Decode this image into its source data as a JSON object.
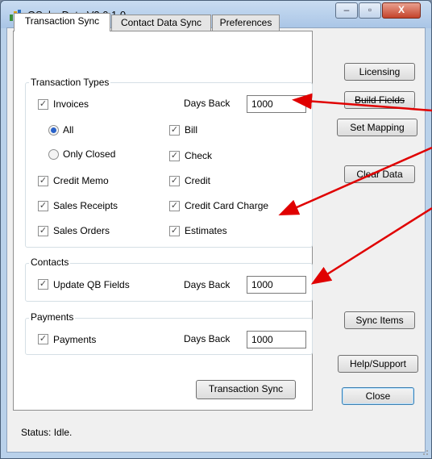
{
  "window": {
    "title": "QSalesData V3.0.1.0",
    "controls": {
      "minimize": "–",
      "maximize": "▫",
      "close": "X"
    }
  },
  "tabs": [
    {
      "label": "Transaction Sync",
      "active": true
    },
    {
      "label": "Contact Data Sync",
      "active": false
    },
    {
      "label": "Preferences",
      "active": false
    }
  ],
  "transaction_types": {
    "title": "Transaction Types",
    "invoices": {
      "label": "Invoices",
      "checked": true
    },
    "days_back_label": "Days Back",
    "days_back_value": "1000",
    "all": {
      "label": "All",
      "selected": true
    },
    "only_closed": {
      "label": "Only Closed",
      "selected": false
    },
    "bill": {
      "label": "Bill",
      "checked": true
    },
    "check": {
      "label": "Check",
      "checked": true
    },
    "credit_memo": {
      "label": "Credit Memo",
      "checked": true
    },
    "credit": {
      "label": "Credit",
      "checked": true
    },
    "sales_receipts": {
      "label": "Sales Receipts",
      "checked": true
    },
    "credit_card_charge": {
      "label": "Credit Card Charge",
      "checked": true
    },
    "sales_orders": {
      "label": "Sales Orders",
      "checked": true
    },
    "estimates": {
      "label": "Estimates",
      "checked": true
    }
  },
  "contacts": {
    "title": "Contacts",
    "update_qb_fields": {
      "label": "Update QB Fields",
      "checked": true
    },
    "days_back_label": "Days Back",
    "days_back_value": "1000"
  },
  "payments": {
    "title": "Payments",
    "payments": {
      "label": "Payments",
      "checked": true
    },
    "days_back_label": "Days Back",
    "days_back_value": "1000"
  },
  "buttons": {
    "transaction_sync": "Transaction Sync",
    "licensing": "Licensing",
    "build_fields": "Build Fields",
    "set_mapping": "Set Mapping",
    "clear_data": "Clear Data",
    "sync_items": "Sync Items",
    "help_support": "Help/Support",
    "close": "Close"
  },
  "status": "Status: Idle.",
  "colors": {
    "annotation_arrow": "#e00000",
    "radio_selected": "#2a62c9"
  }
}
